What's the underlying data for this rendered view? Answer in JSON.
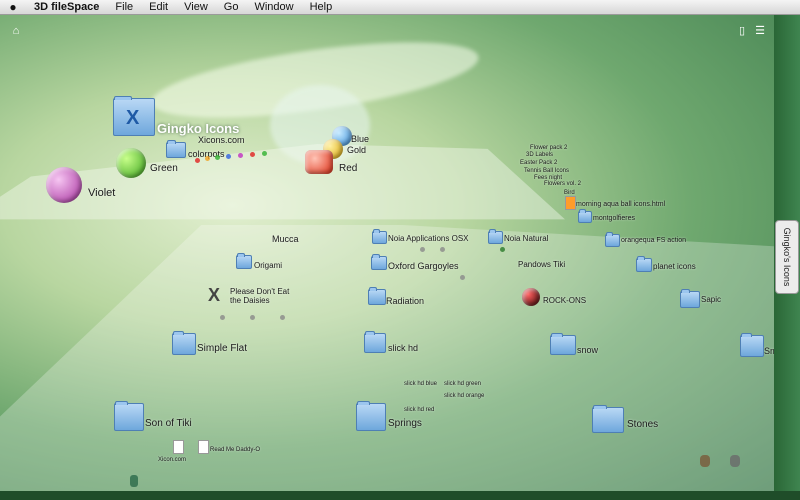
{
  "menubar": {
    "app": "3D fileSpace",
    "items": [
      "File",
      "Edit",
      "View",
      "Go",
      "Window",
      "Help"
    ]
  },
  "side_tab": "Gingko's Icons",
  "front_plane": {
    "title": "Gingko Icons",
    "subtitle": "Xicons.com",
    "items": [
      "colorpots",
      "Green",
      "Violet",
      "Blue",
      "Gold",
      "Red"
    ]
  },
  "folders": [
    "Mucca",
    "Noia Applications OSX",
    "Noia Natural",
    "Origami",
    "Oxford Gargoyles",
    "Pandows Tiki",
    "Please Don't Eat the Daisies",
    "Radiation",
    "ROCK-ONS",
    "Simple Flat",
    "slick hd",
    "snow",
    "Son of Tiki",
    "Springs",
    "Stones",
    "montgolfieres",
    "orangequa FS action",
    "planet icons",
    "Sapic",
    "Sm"
  ],
  "small_labels": [
    "Flower pack 2",
    "3D Labels",
    "Easter Pack 2",
    "Tennis Ball Icons",
    "Fees night",
    "Flowers vol. 2",
    "Bird",
    "morning aqua ball icons.html",
    "Xicon.com",
    "Read Me Daddy-O",
    "slick hd blue",
    "slick hd green",
    "slick hd orange",
    "slick hd red"
  ],
  "colors": {
    "accent": "#1f5aa6",
    "menubar": "#e3e3e3"
  }
}
